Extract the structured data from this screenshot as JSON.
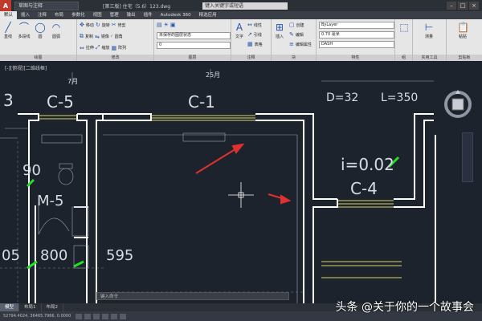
{
  "titlebar": {
    "app_logo": "A",
    "workspace": "草图与注释",
    "document": "[第三版] 住宅（5.6）123.dwg",
    "search_placeholder": "键入关键字或短语",
    "window_buttons": [
      "–",
      "□",
      "×"
    ]
  },
  "ribbon_tabs": [
    "默认",
    "插入",
    "注释",
    "布局",
    "参数化",
    "视图",
    "管理",
    "输出",
    "插件",
    "Autodesk 360",
    "精选应用"
  ],
  "ribbon": {
    "draw": {
      "label": "绘图",
      "buttons": [
        "直线",
        "多段线",
        "圆",
        "圆弧"
      ]
    },
    "modify": {
      "label": "修改",
      "rows": [
        [
          "移动",
          "旋转",
          "修剪"
        ],
        [
          "复制",
          "镜像",
          "圆角"
        ],
        [
          "拉伸",
          "缩放",
          "阵列"
        ]
      ]
    },
    "layer": {
      "label": "图层",
      "combo1": "未保存的图层状态",
      "combo2": "0"
    },
    "annotation": {
      "label": "注释",
      "buttons": [
        "文字",
        "标注"
      ],
      "rows": [
        "线性",
        "引线",
        "表格"
      ]
    },
    "block": {
      "label": "块",
      "buttons": [
        "插入"
      ],
      "rows": [
        "创建",
        "编辑",
        "编辑属性"
      ]
    },
    "properties": {
      "label": "特性",
      "combo1": "ByLayer",
      "combo2": "0.70 毫米",
      "combo3": "DASH"
    },
    "groups": {
      "label": "组"
    },
    "utilities": {
      "label": "实用工具",
      "buttons": [
        "测量"
      ]
    },
    "clipboard": {
      "label": "剪贴板",
      "buttons": [
        "粘贴"
      ]
    }
  },
  "view_label": "[-][俯视][二维线框]",
  "drawing": {
    "labels": [
      "3",
      "C-5",
      "C-1",
      "D=32",
      "L=350",
      "i=0.02",
      "C-4",
      "90",
      "M-5",
      "05",
      "800",
      "595",
      "7月",
      "25月"
    ]
  },
  "cmdline": {
    "placeholder": "键入命令"
  },
  "layout_tabs": [
    "模型",
    "布局1",
    "布局2"
  ],
  "status": {
    "coords": "52794.4024, 36465.7966, 0.0000"
  },
  "watermark": "头条 @关于你的一个故事会"
}
